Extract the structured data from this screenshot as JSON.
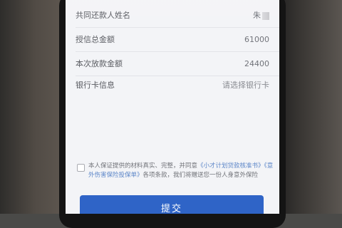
{
  "form": {
    "rows": [
      {
        "label": "共同还款人姓名",
        "value": "朱"
      },
      {
        "label": "授信总金额",
        "value": "61000"
      },
      {
        "label": "本次放款金额",
        "value": "24400"
      },
      {
        "label": "银行卡信息",
        "value": "请选择银行卡"
      }
    ]
  },
  "agreement": {
    "prefix": "本人保证提供的材料真实、完整，并同意",
    "link1": "《小才计划贷款核准书》",
    "link2": "《意外伤害保险投保单》",
    "suffix": "各项条款，我们将赠送您一份人身意外保险"
  },
  "submit": {
    "label": "提交"
  }
}
